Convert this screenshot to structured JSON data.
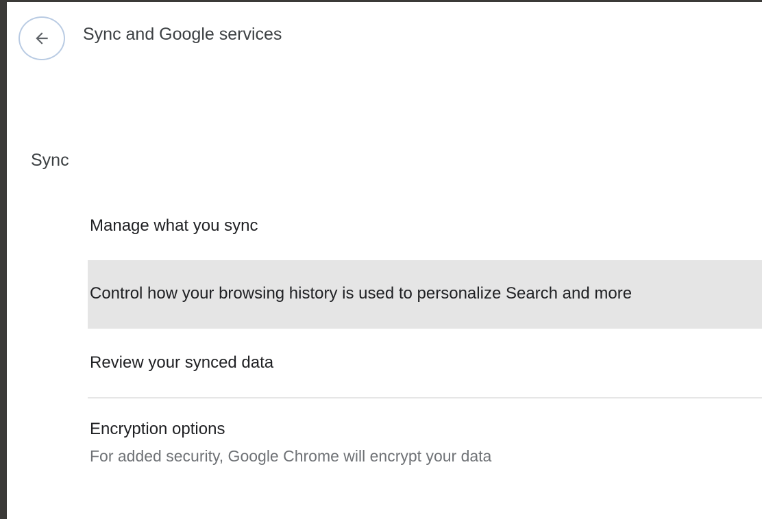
{
  "header": {
    "back_icon": "arrow-left-icon",
    "title": "Sync and Google services"
  },
  "sync_section": {
    "title": "Sync",
    "items": [
      {
        "label": "Manage what you sync"
      },
      {
        "label": "Control how your browsing history is used to personalize Search and more",
        "highlighted": true
      },
      {
        "label": "Review your synced data"
      },
      {
        "label": "Encryption options",
        "sublabel": "For added security, Google Chrome will encrypt your data"
      }
    ]
  },
  "colors": {
    "highlight": "#e5e5e5",
    "back_button_ring": "#b9cbe3",
    "title_text": "#3c4043",
    "secondary_text": "#6f7276"
  }
}
